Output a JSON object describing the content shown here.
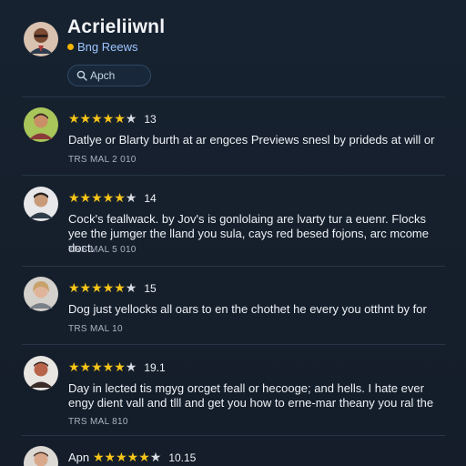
{
  "header": {
    "title": "Acrieliiwnl",
    "subtitle": "Bng Reews",
    "subtitle_dot_color": "#f4b400",
    "avatar_icon": "profile-avatar"
  },
  "search": {
    "placeholder": "Apch",
    "icon": "search-icon"
  },
  "colors": {
    "background": "#16202d",
    "star_filled": "#f7c518",
    "star_empty": "#d9dde3",
    "accent": "#9cc6ff"
  },
  "reviews": [
    {
      "rating_filled": 4,
      "rating_total": 5,
      "stars_text_filled": "★★★★★",
      "stars_text_empty": "★",
      "count": "13",
      "text": "Datlye or Blarty burth at ar engces Previews snesl by prideds at will or",
      "meta": "TRS MAL 2 010"
    },
    {
      "rating_filled": 4,
      "rating_total": 5,
      "stars_text_filled": "★★★★★",
      "stars_text_empty": "★",
      "count": "14",
      "text": "Cock's feallwack. by Jov's is gonlolaing are lvarty tur a euenr. Flocks yee the jumger the lland you sula, cays red besed fojons, arc mcome doct.",
      "meta": "TRS MAL 5 010"
    },
    {
      "rating_filled": 4,
      "rating_total": 5,
      "stars_text_filled": "★★★★★",
      "stars_text_empty": "★",
      "count": "15",
      "text": "Dog just yellocks all oars to en the chothet he every you otthnt by for",
      "meta": "TRS MAL 10"
    },
    {
      "rating_filled": 4,
      "rating_total": 5,
      "stars_text_filled": "★★★★★",
      "stars_text_empty": "★",
      "count": "19.1",
      "text": "Day in lected tis mgyg orcget feall or hecooge; and hells. I hate ever engy dient vall and tlll and get you how to erne-mar theany you ral the",
      "meta": "TRS MAL 810"
    },
    {
      "rating_filled": 4,
      "rating_total": 5,
      "stars_text_filled": "★★★★★",
      "stars_text_empty": "★",
      "count": "10.15",
      "name": "Apn",
      "text": "",
      "meta": ""
    }
  ]
}
